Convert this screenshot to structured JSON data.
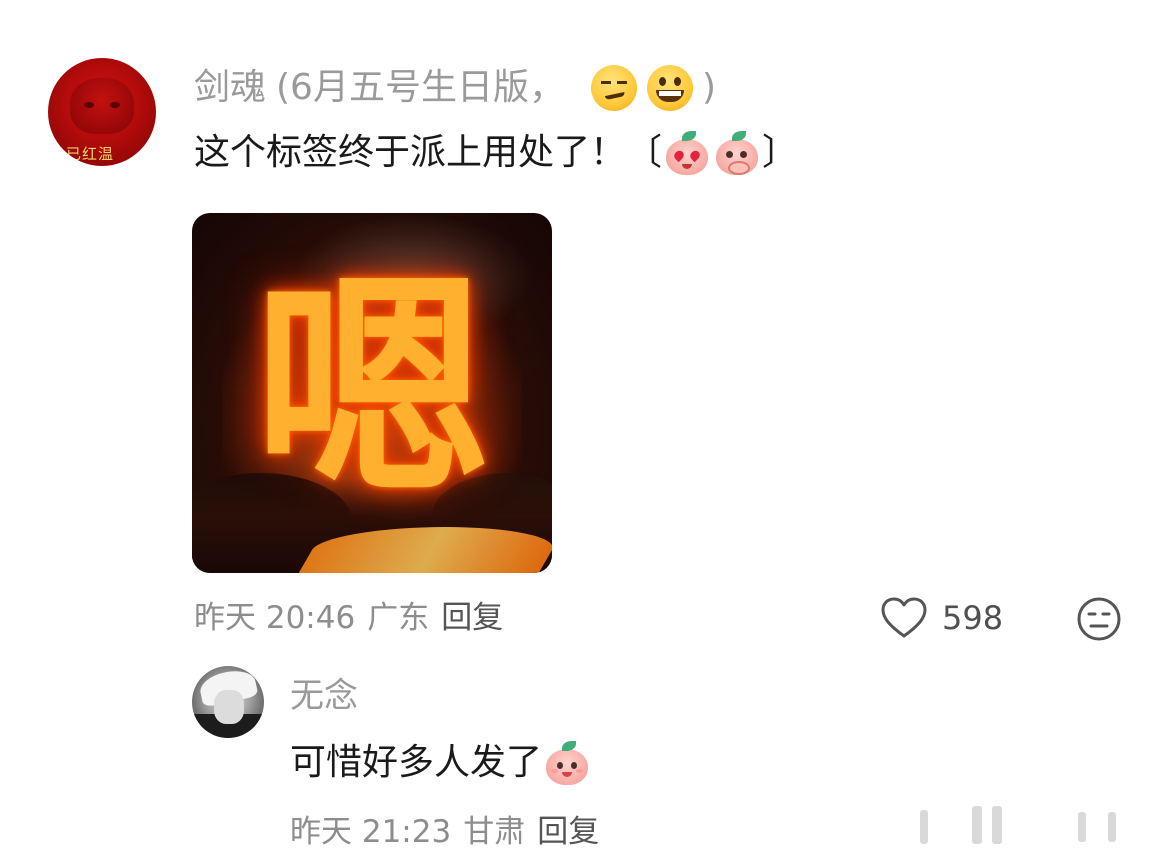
{
  "comment": {
    "username": "剑魂",
    "username_suffix": "(6月五号生日版，",
    "username_close": ")",
    "avatar_text": "已红温",
    "text": "这个标签终于派上用处了！",
    "bracket_open": "〔",
    "bracket_close": "〕",
    "image_glyph": "嗯",
    "time": "昨天 20:46",
    "location": "广东",
    "reply_label": "回复",
    "like_count": "598",
    "icons": [
      "smirk-emoji-icon",
      "grin-emoji-icon",
      "peach-heart-eyes-icon",
      "peach-shy-icon",
      "heart-outline-icon",
      "neutral-face-icon"
    ]
  },
  "reply": {
    "username": "无念",
    "text": "可惜好多人发了",
    "time": "昨天 21:23",
    "location": "甘肃",
    "reply_label": "回复",
    "icons": [
      "peach-smile-icon"
    ]
  },
  "colors": {
    "username": "#9a9a9a",
    "text": "#1a1a1a",
    "meta": "#8d8d8d",
    "avatar_red": "#c21010"
  }
}
